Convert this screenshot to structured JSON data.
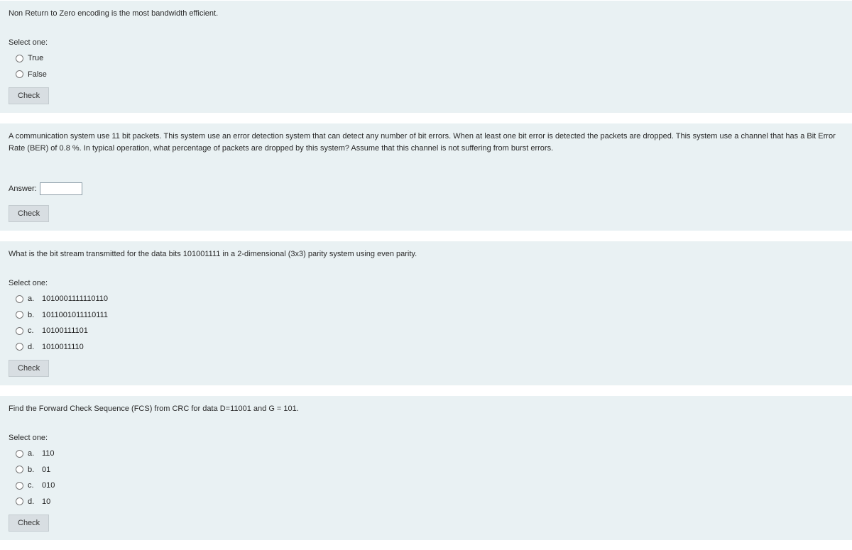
{
  "common": {
    "select_one": "Select one:",
    "check_label": "Check",
    "answer_label": "Answer:"
  },
  "q1": {
    "text": "Non Return to Zero encoding is the most bandwidth efficient.",
    "options": [
      {
        "label": "True"
      },
      {
        "label": "False"
      }
    ]
  },
  "q2": {
    "text": "A communication system use 11 bit packets. This system use an error detection system that can detect any number of bit errors. When at least one bit error is detected the packets are dropped. This system use a channel that has a Bit Error Rate (BER) of 0.8 %. In typical operation, what percentage of packets are dropped by this system?  Assume that this channel is not suffering from burst errors."
  },
  "q3": {
    "text": "What is the bit stream transmitted for the data bits 101001111 in a 2-dimensional (3x3) parity system using even parity.",
    "options": [
      {
        "letter": "a.",
        "label": "1010001111110110"
      },
      {
        "letter": "b.",
        "label": "1011001011110111"
      },
      {
        "letter": "c.",
        "label": "10100111101"
      },
      {
        "letter": "d.",
        "label": "1010011110"
      }
    ]
  },
  "q4": {
    "text": "Find the Forward Check Sequence (FCS) from CRC for data D=11001 and G = 101.",
    "options": [
      {
        "letter": "a.",
        "label": "110"
      },
      {
        "letter": "b.",
        "label": "01"
      },
      {
        "letter": "c.",
        "label": "010"
      },
      {
        "letter": "d.",
        "label": "10"
      }
    ]
  }
}
